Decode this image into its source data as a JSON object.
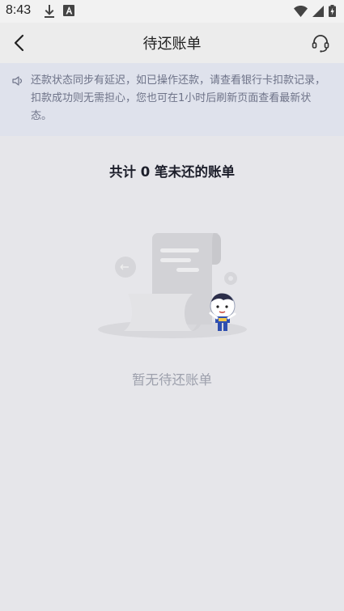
{
  "status_bar": {
    "time": "8:43"
  },
  "header": {
    "title": "待还账单"
  },
  "notice": {
    "text": "还款状态同步有延迟，如已操作还款，请查看银行卡扣款记录，扣款成功则无需担心，您也可在1小时后刷新页面查看最新状态。"
  },
  "summary": {
    "text": "共计 0 笔未还的账单"
  },
  "empty_state": {
    "text": "暂无待还账单"
  },
  "colors": {
    "background": "#e6e6ea",
    "notice_background": "#dfe2ec",
    "notice_text": "#6e7388"
  }
}
